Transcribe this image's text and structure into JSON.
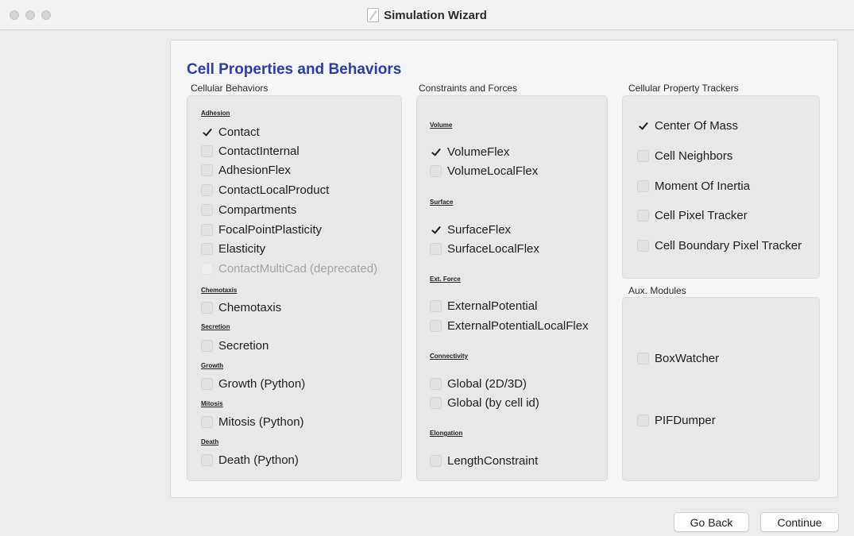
{
  "window": {
    "title": "Simulation Wizard"
  },
  "page": {
    "heading": "Cell Properties and Behaviors"
  },
  "columns": {
    "behaviors": {
      "label": "Cellular Behaviors",
      "categories": {
        "adhesion": "Adhesion",
        "chemotaxis": "Chemotaxis",
        "secretion": "Secretion",
        "growth": "Growth",
        "mitosis": "Mitosis",
        "death": "Death"
      },
      "items": [
        {
          "label": "Contact",
          "checked": true
        },
        {
          "label": "ContactInternal",
          "checked": false
        },
        {
          "label": "AdhesionFlex",
          "checked": false
        },
        {
          "label": "ContactLocalProduct",
          "checked": false
        },
        {
          "label": "Compartments",
          "checked": false
        },
        {
          "label": "FocalPointPlasticity",
          "checked": false
        },
        {
          "label": "Elasticity",
          "checked": false
        },
        {
          "label": "ContactMultiCad (deprecated)",
          "checked": false,
          "disabled": true
        },
        {
          "label": "Chemotaxis",
          "checked": false
        },
        {
          "label": "Secretion",
          "checked": false
        },
        {
          "label": "Growth (Python)",
          "checked": false
        },
        {
          "label": "Mitosis (Python)",
          "checked": false
        },
        {
          "label": "Death (Python)",
          "checked": false
        }
      ]
    },
    "constraints": {
      "label": "Constraints and Forces",
      "categories": {
        "volume": "Volume",
        "surface": "Surface",
        "ext_force": "Ext. Force",
        "connectivity": "Connectivity",
        "elongation": "Elongation"
      },
      "items": [
        {
          "label": "VolumeFlex",
          "checked": true
        },
        {
          "label": "VolumeLocalFlex",
          "checked": false
        },
        {
          "label": "SurfaceFlex",
          "checked": true
        },
        {
          "label": "SurfaceLocalFlex",
          "checked": false
        },
        {
          "label": "ExternalPotential",
          "checked": false
        },
        {
          "label": "ExternalPotentialLocalFlex",
          "checked": false
        },
        {
          "label": "Global (2D/3D)",
          "checked": false
        },
        {
          "label": "Global (by cell id)",
          "checked": false
        },
        {
          "label": "LengthConstraint",
          "checked": false
        }
      ]
    },
    "trackers": {
      "label": "Cellular Property Trackers",
      "items": [
        {
          "label": "Center Of Mass",
          "checked": true
        },
        {
          "label": "Cell Neighbors",
          "checked": false
        },
        {
          "label": "Moment Of Inertia",
          "checked": false
        },
        {
          "label": "Cell Pixel Tracker",
          "checked": false
        },
        {
          "label": "Cell Boundary Pixel Tracker",
          "checked": false
        }
      ]
    },
    "aux": {
      "label": "Aux. Modules",
      "items": [
        {
          "label": "BoxWatcher",
          "checked": false
        },
        {
          "label": "PIFDumper",
          "checked": false
        }
      ]
    }
  },
  "buttons": {
    "back": "Go Back",
    "continue": "Continue"
  }
}
